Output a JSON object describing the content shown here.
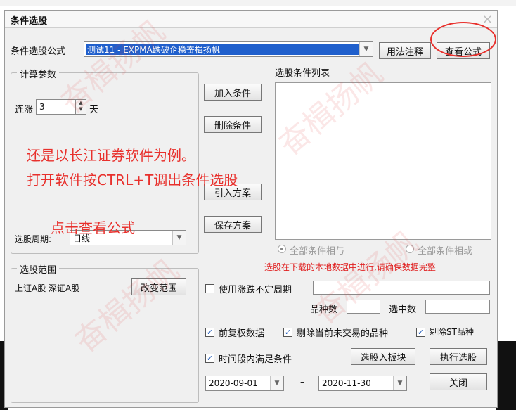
{
  "dialog": {
    "title": "条件选股",
    "close_glyph": "×"
  },
  "formula": {
    "label": "条件选股公式",
    "value": "测试11          - EXPMA跌破企稳奋楫扬帆",
    "usage_button": "用法注释",
    "view_button": "查看公式"
  },
  "params": {
    "group_title": "计算参数",
    "consecutive_label": "连涨",
    "consecutive_value": "3",
    "unit": "天"
  },
  "actions": {
    "add": "加入条件",
    "delete": "删除条件",
    "import_plan": "引入方案",
    "save_plan": "保存方案"
  },
  "conditions": {
    "list_label": "选股条件列表",
    "radio_and": "全部条件相与",
    "radio_or": "全部条件相或",
    "notice": "选股在下载的本地数据中进行,请确保数据完整"
  },
  "period": {
    "label": "选股周期:",
    "value": "日线"
  },
  "range": {
    "group_title": "选股范围",
    "markets": "上证A股 深证A股",
    "change_button": "改变范围"
  },
  "options": {
    "use_undetermined": "使用涨跌不定周期",
    "count_label": "品种数",
    "selected_label": "选中数",
    "forward_adjust": "前复权数据",
    "exclude_untraded": "剔除当前未交易的品种",
    "exclude_st": "剔除ST品种",
    "time_range": "时间段内满足条件",
    "check_mark": "✓"
  },
  "bottom": {
    "to_block": "选股入板块",
    "execute": "执行选股",
    "close": "关闭",
    "date_from": "2020-09-01",
    "date_sep": "–",
    "date_to": "2020-11-30"
  },
  "annotations": {
    "line1": "还是以长江证券软件为例。",
    "line2": "打开软件按CTRL+T调出条件选股",
    "line3": "点击查看公式"
  },
  "watermark": "奋楫扬帆"
}
